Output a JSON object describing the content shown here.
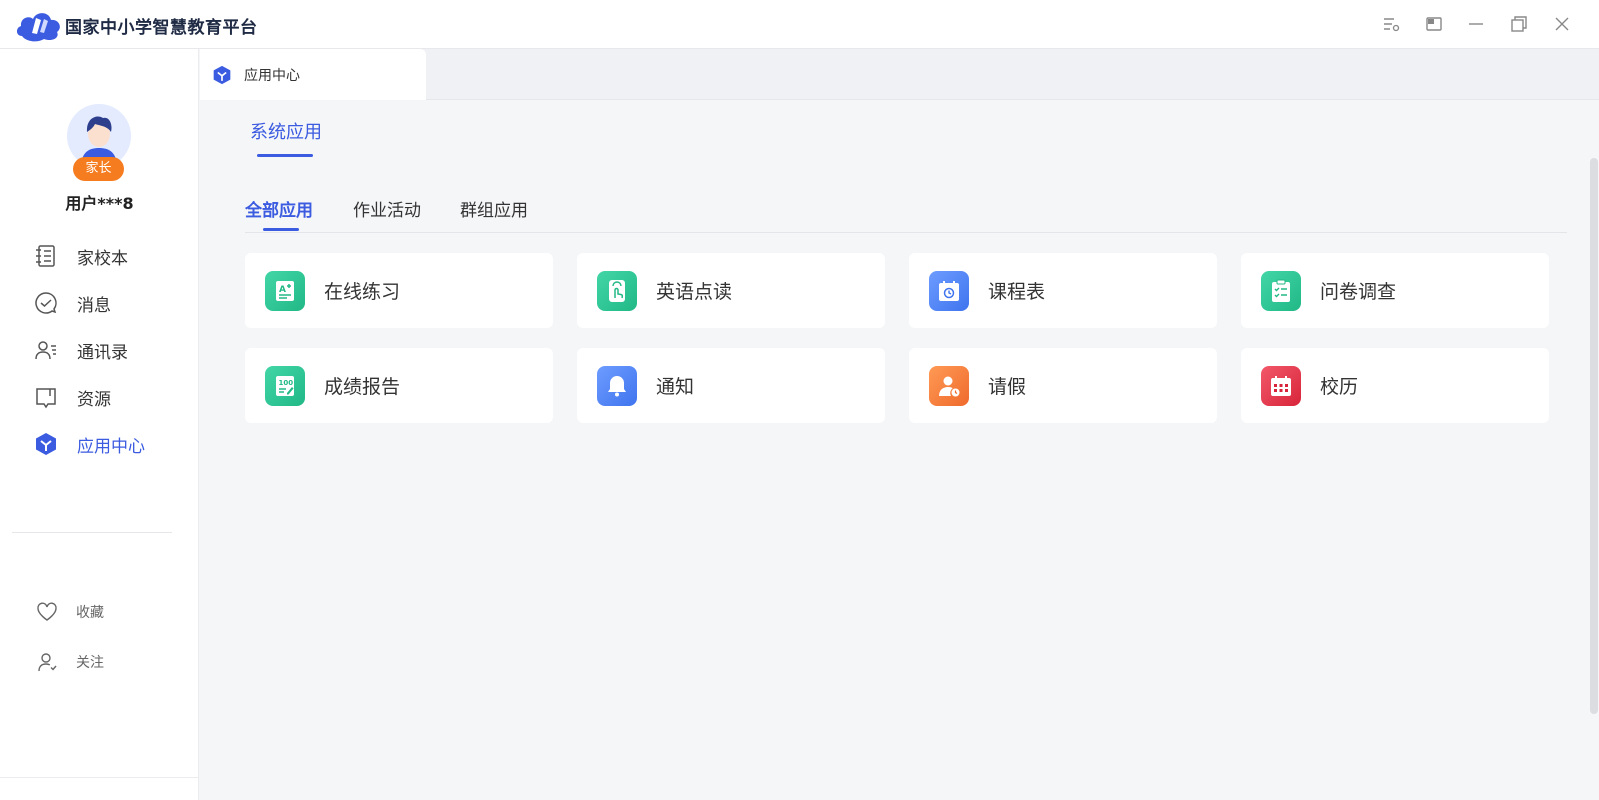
{
  "app": {
    "title": "国家中小学智慧教育平台"
  },
  "window_controls": [
    "settings-icon",
    "picture-in-picture-icon",
    "minimize-icon",
    "restore-icon",
    "close-icon"
  ],
  "user": {
    "role": "家长",
    "name": "用户***8"
  },
  "sidebar": {
    "items": [
      {
        "label": "家校本",
        "icon": "notebook-icon"
      },
      {
        "label": "消息",
        "icon": "message-check-icon"
      },
      {
        "label": "通讯录",
        "icon": "contacts-icon"
      },
      {
        "label": "资源",
        "icon": "book-icon"
      },
      {
        "label": "应用中心",
        "icon": "app-center-icon",
        "active": true
      }
    ],
    "sub_items": [
      {
        "label": "收藏",
        "icon": "heart-icon"
      },
      {
        "label": "关注",
        "icon": "user-follow-icon"
      }
    ]
  },
  "page_tab": {
    "label": "应用中心"
  },
  "section": {
    "title": "系统应用"
  },
  "categories": [
    {
      "label": "全部应用",
      "active": true
    },
    {
      "label": "作业活动"
    },
    {
      "label": "群组应用"
    }
  ],
  "apps": [
    {
      "label": "在线练习",
      "icon": "practice-icon",
      "color": "#2fc79a"
    },
    {
      "label": "英语点读",
      "icon": "touch-read-icon",
      "color": "#2fc79a"
    },
    {
      "label": "课程表",
      "icon": "schedule-icon",
      "color": "#4f86f7"
    },
    {
      "label": "问卷调查",
      "icon": "survey-icon",
      "color": "#2fc79a"
    },
    {
      "label": "成绩报告",
      "icon": "score-report-icon",
      "color": "#2fc79a"
    },
    {
      "label": "通知",
      "icon": "bell-icon",
      "color": "#4f86f7"
    },
    {
      "label": "请假",
      "icon": "leave-icon",
      "color": "#f57f3c"
    },
    {
      "label": "校历",
      "icon": "calendar-icon",
      "color": "#e8364b"
    }
  ],
  "colors": {
    "accent": "#3b5be0",
    "badge": "#f57c1f"
  }
}
